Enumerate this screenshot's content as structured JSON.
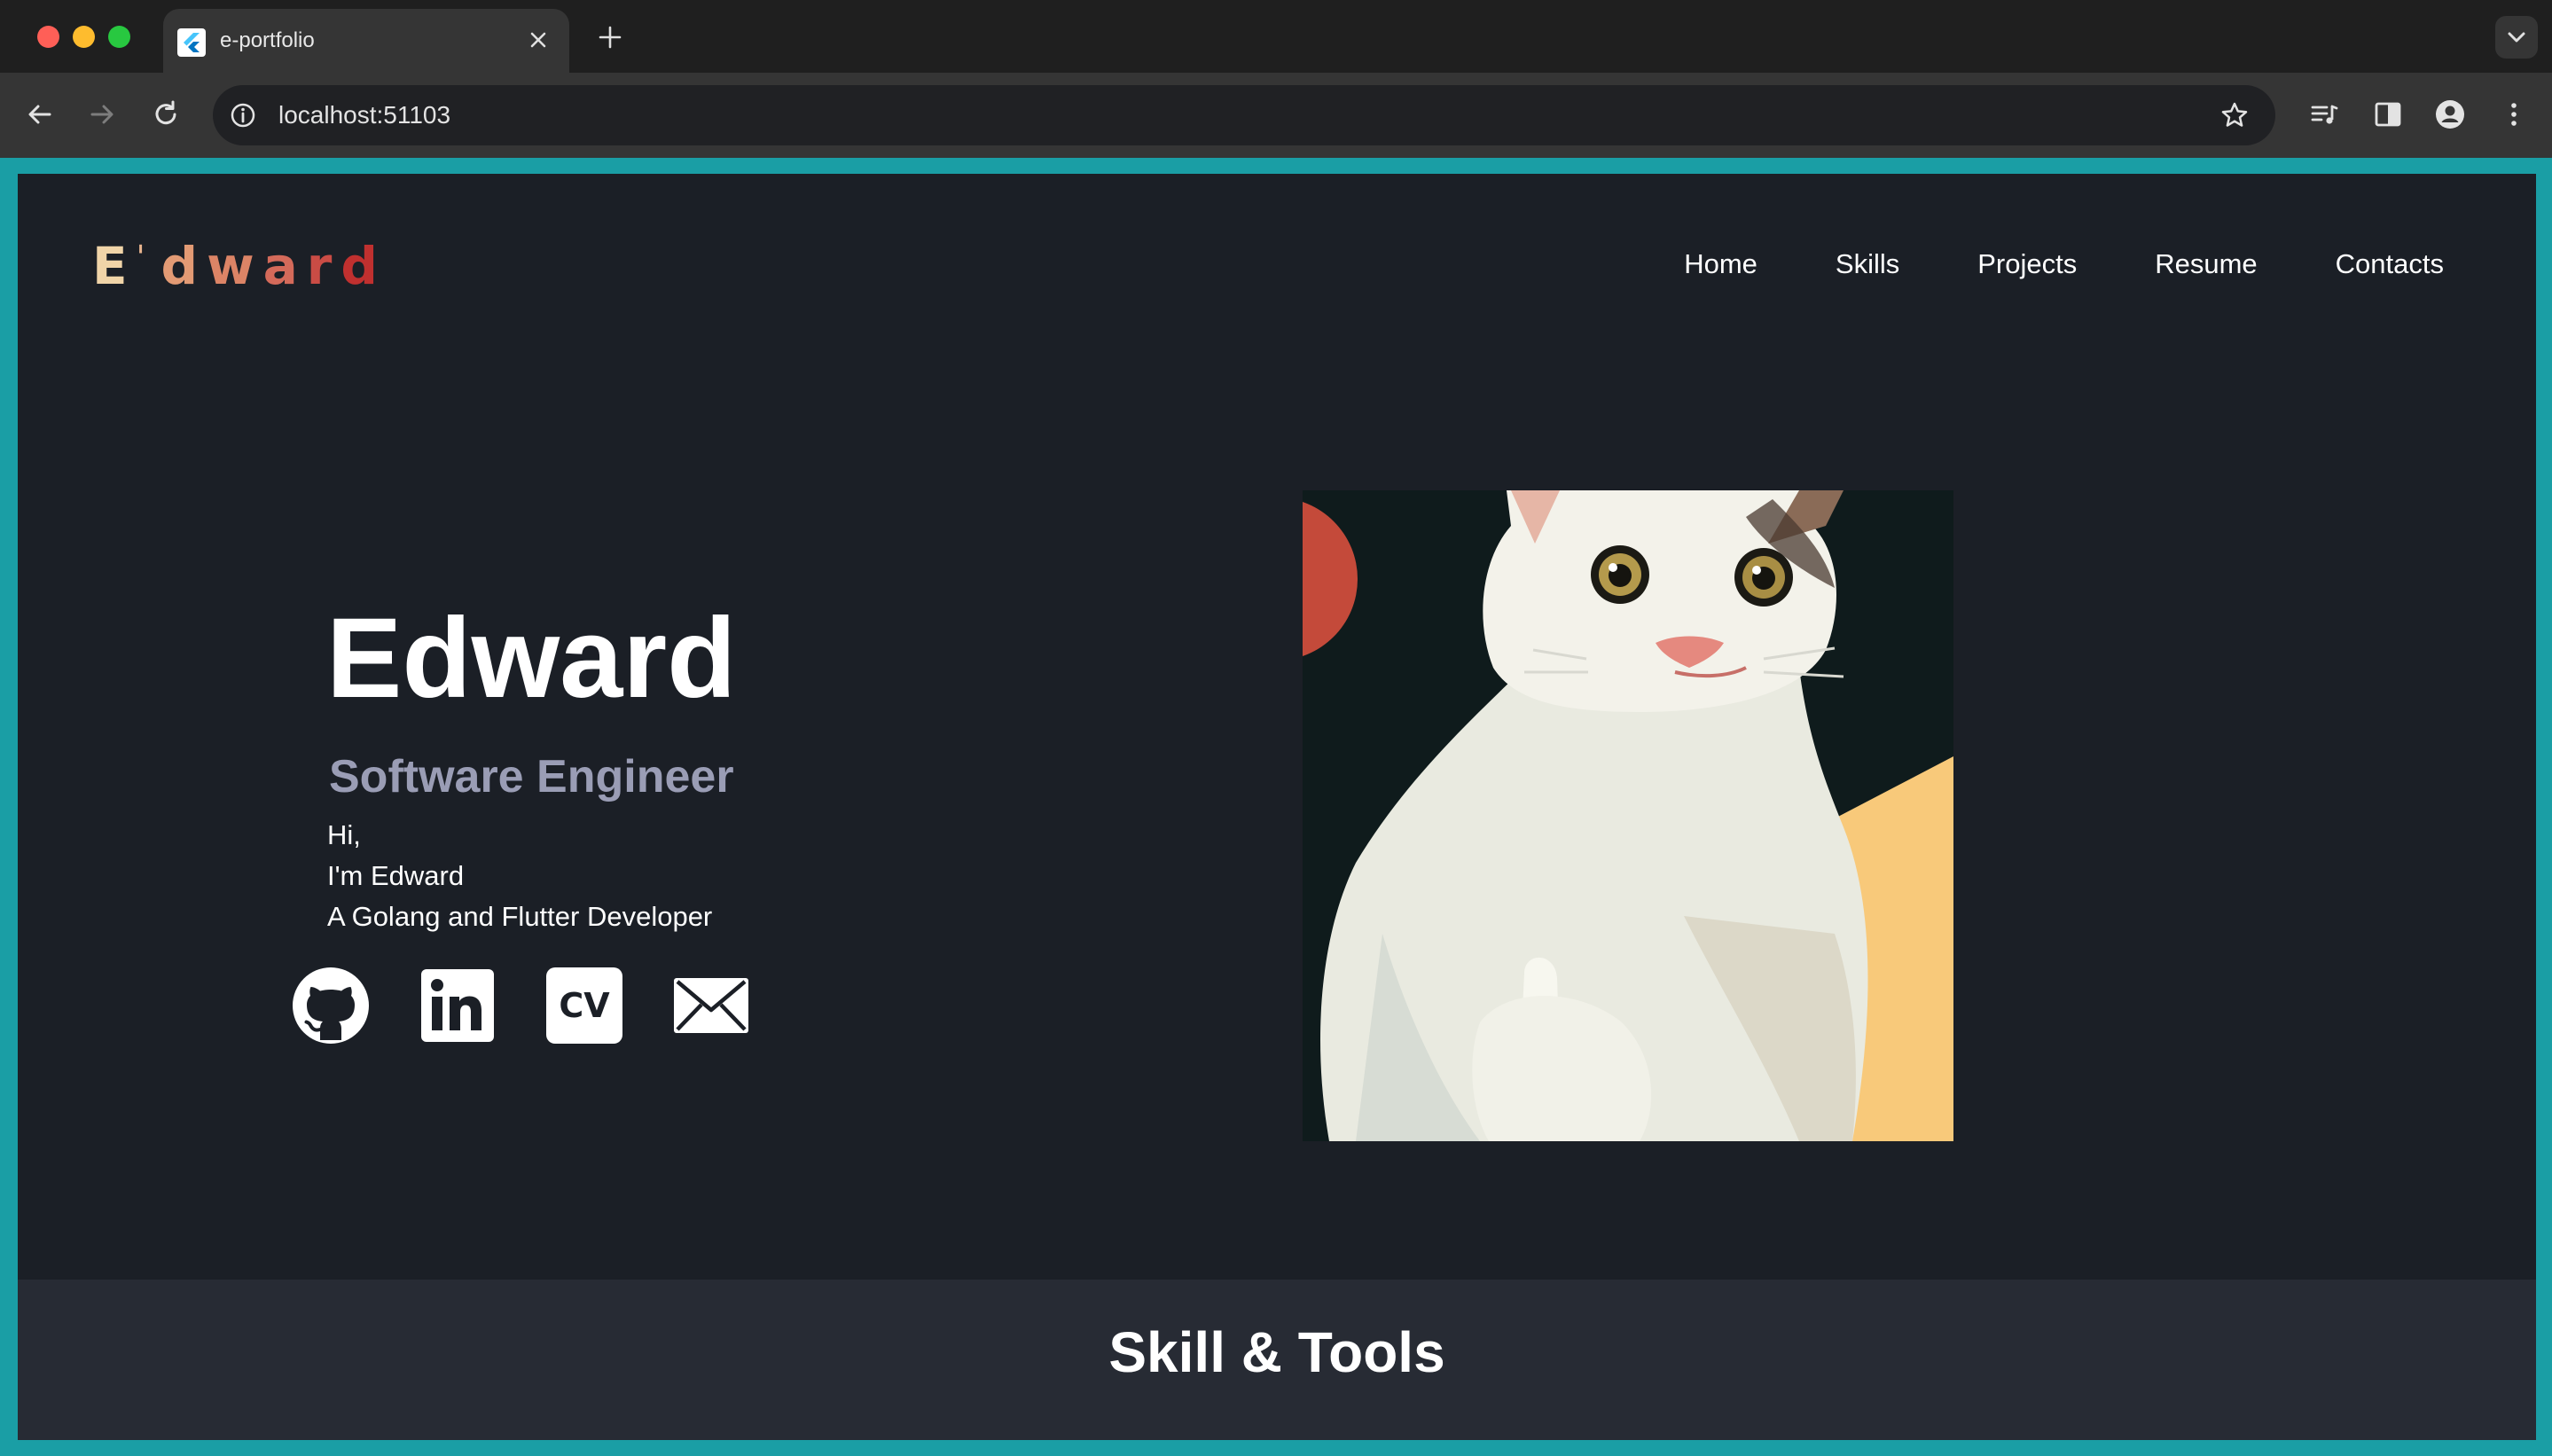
{
  "browser": {
    "tab_title": "e-portfolio",
    "url": "localhost:51103",
    "icons": [
      "flutter-favicon-icon",
      "close-icon",
      "plus-icon",
      "chevron-down-icon",
      "back-arrow-icon",
      "forward-arrow-icon",
      "reload-icon",
      "info-icon",
      "star-icon",
      "media-queue-icon",
      "side-panel-icon",
      "profile-icon",
      "more-vert-icon"
    ]
  },
  "header": {
    "logo": [
      "E",
      "'",
      "d",
      "w",
      "a",
      "r",
      "d"
    ],
    "nav": [
      "Home",
      "Skills",
      "Projects",
      "Resume",
      "Contacts"
    ]
  },
  "hero": {
    "name": "Edward",
    "role": "Software Engineer",
    "greeting": "Hi,",
    "intro": "I'm Edward",
    "tagline": "A Golang and Flutter Developer",
    "socials": [
      "github-icon",
      "linkedin-icon",
      "cv-icon",
      "mail-icon"
    ],
    "cv_label": "CV",
    "portrait": "illustrated white cat"
  },
  "skills": {
    "title": "Skill & Tools"
  },
  "colors": {
    "frame": "#1a9ea5",
    "page_bg": "#1b1f26",
    "band_bg": "#272b34",
    "role_text": "#9a9db5",
    "logo_gradient": [
      "#f0d4a8",
      "#e8a07a",
      "#d46a5a",
      "#c0302f"
    ]
  }
}
